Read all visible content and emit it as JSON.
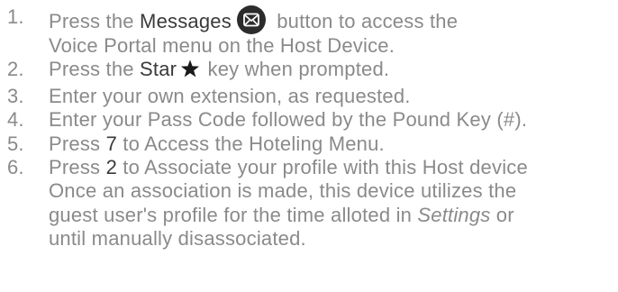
{
  "steps": [
    {
      "number": "1.",
      "pre": "Press the ",
      "highlight": "Messages",
      "post_line1": " button to access the",
      "line2": "Voice Portal menu on the Host Device.",
      "icon": "envelope-icon"
    },
    {
      "number": "2.",
      "pre": "Press the ",
      "highlight": "Star",
      "post": " key when prompted.",
      "icon": "star-icon"
    },
    {
      "number": "3.",
      "text": "Enter your own extension, as requested."
    },
    {
      "number": "4.",
      "text": "Enter your Pass Code followed by the Pound Key (#)."
    },
    {
      "number": "5.",
      "pre": "Press ",
      "highlight": "7",
      "post": " to Access the Hoteling Menu."
    },
    {
      "number": "6.",
      "pre": "Press ",
      "highlight": "2",
      "post": " to Associate your profile with this Host device",
      "line2": "Once an association is made, this device utilizes the",
      "line3_pre": "guest user's profile for the time alloted in ",
      "line3_italic": "Settings",
      "line3_post": " or",
      "line4": "until manually disassociated."
    }
  ],
  "colors": {
    "body_text": "#8a8a8a",
    "highlight_text": "#3a3a3a",
    "icon_fill": "#2c2c2c"
  }
}
